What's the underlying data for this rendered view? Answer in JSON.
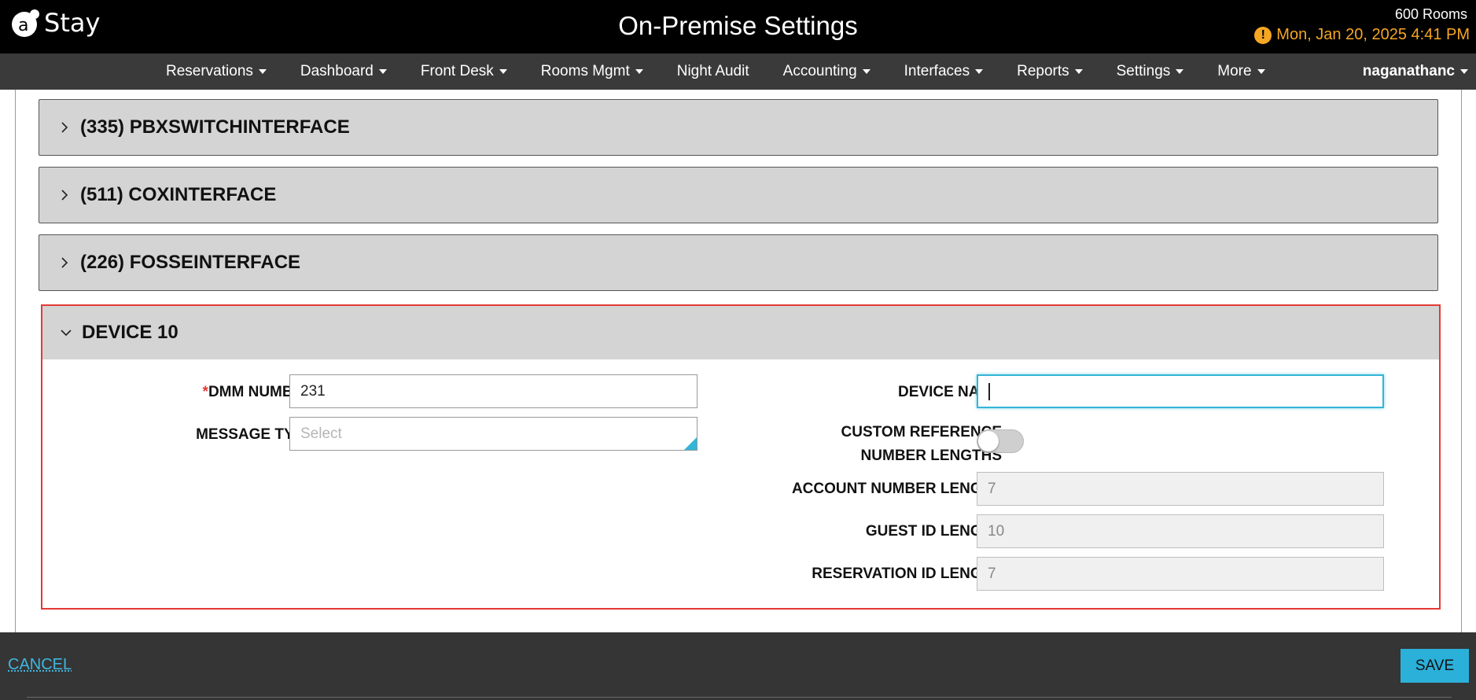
{
  "header": {
    "logo_text": "Stay",
    "title": "On-Premise Settings",
    "rooms": "600 Rooms",
    "datetime": "Mon, Jan 20, 2025 4:41 PM",
    "alert_symbol": "!"
  },
  "nav": {
    "items": [
      {
        "label": "Reservations",
        "dropdown": true
      },
      {
        "label": "Dashboard",
        "dropdown": true
      },
      {
        "label": "Front Desk",
        "dropdown": true
      },
      {
        "label": "Rooms Mgmt",
        "dropdown": true
      },
      {
        "label": "Night Audit",
        "dropdown": false
      },
      {
        "label": "Accounting",
        "dropdown": true
      },
      {
        "label": "Interfaces",
        "dropdown": true
      },
      {
        "label": "Reports",
        "dropdown": true
      },
      {
        "label": "Settings",
        "dropdown": true
      },
      {
        "label": "More",
        "dropdown": true
      }
    ],
    "user": "naganathanc"
  },
  "panels": [
    {
      "title": "(335) PBXSWITCHINTERFACE"
    },
    {
      "title": "(511) COXINTERFACE"
    },
    {
      "title": "(226) FOSSEINTERFACE"
    }
  ],
  "device": {
    "title": "DEVICE 10",
    "dmm_label": "DMM NUMBER",
    "dmm_required": "*",
    "dmm_value": "231",
    "message_type_label": "MESSAGE TYPE",
    "message_type_placeholder": "Select",
    "device_name_label": "DEVICE NAME",
    "device_name_value": "",
    "custom_ref_label_1": "CUSTOM REFERENCE",
    "custom_ref_label_2": "NUMBER LENGTHS",
    "custom_ref_enabled": false,
    "account_length_label": "ACCOUNT NUMBER LENGTH",
    "account_length_value": "7",
    "guest_id_label": "GUEST ID LENGTH",
    "guest_id_value": "10",
    "reservation_id_label": "RESERVATION ID LENGTH",
    "reservation_id_value": "7"
  },
  "footer": {
    "cancel_label": "CANCEL",
    "save_label": "SAVE"
  },
  "colors": {
    "accent": "#2bb0d9",
    "alert": "#f5a623",
    "highlight_border": "#e53935"
  }
}
